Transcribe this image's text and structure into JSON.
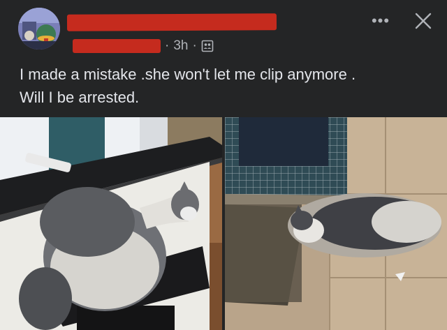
{
  "post": {
    "time": "3h",
    "separator": "·",
    "audience_icon": "friends-audience-icon",
    "text_line1": "I made a mistake .she won't let me clip anymore .",
    "text_line2": "Will I be arrested."
  },
  "header": {
    "more_label": "•••",
    "close_icon": "close-icon"
  },
  "photos": [
    {
      "name": "cat-on-stool-photo"
    },
    {
      "name": "cat-on-tile-floor-photo"
    }
  ],
  "colors": {
    "background": "#242526",
    "redaction": "#c52b1e",
    "text_primary": "#e4e6eb",
    "text_secondary": "#b0b3b8"
  }
}
